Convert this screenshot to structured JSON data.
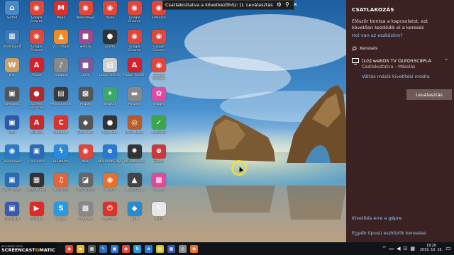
{
  "desktop": {
    "icons": [
      {
        "label": "Sorted",
        "glyph": "⌂",
        "color": "#4a89c8"
      },
      {
        "label": "Google Chrome",
        "glyph": "◉",
        "color": "#e0463a"
      },
      {
        "label": "Mega",
        "glyph": "M",
        "color": "#d9302c"
      },
      {
        "label": "WebsiteSpa",
        "glyph": "◉",
        "color": "#e0463a"
      },
      {
        "label": "fájlok",
        "glyph": "◉",
        "color": "#e0463a"
      },
      {
        "label": "Google Chrome",
        "glyph": "◉",
        "color": "#e0463a"
      },
      {
        "label": "eszközök",
        "glyph": "◉",
        "color": "#e0463a"
      },
      {
        "label": "Vezérlőpult",
        "glyph": "▦",
        "color": "#3c78b4"
      },
      {
        "label": "Google Chrome",
        "glyph": "◉",
        "color": "#e0463a"
      },
      {
        "label": "VLC Player",
        "glyph": "▲",
        "color": "#f28b22"
      },
      {
        "label": "webOS",
        "glyph": "■",
        "color": "#a04a8c"
      },
      {
        "label": "panda",
        "glyph": "●",
        "color": "#333333"
      },
      {
        "label": "Google Chrome",
        "glyph": "◉",
        "color": "#e0463a"
      },
      {
        "label": "Google Chrome",
        "glyph": "◉",
        "color": "#e0463a"
      },
      {
        "label": "Wiki",
        "glyph": "W",
        "color": "#c9a06a"
      },
      {
        "label": "Adobe",
        "glyph": "A",
        "color": "#d4202a"
      },
      {
        "label": "hangulat",
        "glyph": "♪",
        "color": "#888888"
      },
      {
        "label": "Lomo",
        "glyph": "■",
        "color": "#7a5a9a"
      },
      {
        "label": "Dokumentum",
        "glyph": "▤",
        "color": "#cfcfcf"
      },
      {
        "label": "Adobe Reader",
        "glyph": "A",
        "color": "#d4202a"
      },
      {
        "label": "Google Chrome",
        "glyph": "◉",
        "color": "#e0463a"
      },
      {
        "label": "Videószerk.",
        "glyph": "▣",
        "color": "#555555"
      },
      {
        "label": "Screen Recorder",
        "glyph": "●",
        "color": "#b02a2a"
      },
      {
        "label": "Media Center",
        "glyph": "▤",
        "color": "#3a3a3a"
      },
      {
        "label": "Mobile",
        "glyph": "▩",
        "color": "#555555"
      },
      {
        "label": "Network",
        "glyph": "✦",
        "color": "#3aa86a"
      },
      {
        "label": "Resolve",
        "glyph": "▬",
        "color": "#888888"
      },
      {
        "label": "Images",
        "glyph": "✿",
        "color": "#e04aa0"
      },
      {
        "label": "Intel",
        "glyph": "▣",
        "color": "#2a5aa8"
      },
      {
        "label": "ACDSee",
        "glyph": "A",
        "color": "#c82a2a"
      },
      {
        "label": "CCleaner",
        "glyph": "C",
        "color": "#d8342a"
      },
      {
        "label": "Game Ally",
        "glyph": "◆",
        "color": "#555555"
      },
      {
        "label": "Guardian",
        "glyph": "●",
        "color": "#333333"
      },
      {
        "label": "DVD Maker",
        "glyph": "◎",
        "color": "#b85a2a"
      },
      {
        "label": "Antivirus",
        "glyph": "✓",
        "color": "#3aa84a"
      },
      {
        "label": "TeamViewer",
        "glyph": "◉",
        "color": "#2a7ac8"
      },
      {
        "label": "Converter",
        "glyph": "▣",
        "color": "#2a6ab8"
      },
      {
        "label": "Bluetooth",
        "glyph": "ϟ",
        "color": "#2a8ae0"
      },
      {
        "label": "Web",
        "glyph": "◉",
        "color": "#e0463a"
      },
      {
        "label": "Microsoft Edge",
        "glyph": "e",
        "color": "#2a78d0"
      },
      {
        "label": "Maintenance",
        "glyph": "✹",
        "color": "#333333"
      },
      {
        "label": "Sense",
        "glyph": "⊕",
        "color": "#c83a3a"
      },
      {
        "label": "SWF Player",
        "glyph": "▣",
        "color": "#2a6ab8"
      },
      {
        "label": "WebOS File",
        "glyph": "▦",
        "color": "#333333"
      },
      {
        "label": "Audacity",
        "glyph": "♫",
        "color": "#e0663a"
      },
      {
        "label": "DVD Studio",
        "glyph": "◪",
        "color": "#666666"
      },
      {
        "label": "Firefox",
        "glyph": "◉",
        "color": "#e8702a"
      },
      {
        "label": "Photoshop",
        "glyph": "▲",
        "color": "#444444"
      },
      {
        "label": "Palette",
        "glyph": "▦",
        "color": "#e04a9a"
      },
      {
        "label": "Cyberlink",
        "glyph": "▣",
        "color": "#3a5ab0"
      },
      {
        "label": "YouTube",
        "glyph": "▶",
        "color": "#e02a2a"
      },
      {
        "label": "Skype",
        "glyph": "S",
        "color": "#2a9ae0"
      },
      {
        "label": "Program",
        "glyph": "▩",
        "color": "#888888"
      },
      {
        "label": "Recorder",
        "glyph": "⏻",
        "color": "#d8342a"
      },
      {
        "label": "Kodi",
        "glyph": "◆",
        "color": "#2a8ad0"
      },
      {
        "label": "Paint",
        "glyph": "✎",
        "color": "#e8e8e8"
      }
    ]
  },
  "cast_toolbar": {
    "text": "Csatlakoztatva a következőhöz: [L",
    "disconnect": "Leválasztás",
    "gear_glyph": "⚙",
    "pin_glyph": "⚲",
    "close_glyph": "✕"
  },
  "connect_pane": {
    "title": "CSATLAKOZÁS",
    "description": "Először bontsa a kapcsolatot, ezt követően kezdődik el a keresés",
    "where_link": "Hol van az eszközöm?",
    "search_label": "Keresés",
    "device": {
      "name": "[LG] webOS TV OLED55C8PLA",
      "status": "Csatlakoztatva – Másolás",
      "mode_link": "Váltás másik kivetítési módra",
      "disconnect_button": "Leválasztás"
    },
    "project_link": "Kivetítés erre a gépre",
    "other_devices_link": "Egyéb típusú eszközök keresése"
  },
  "taskbar": {
    "brand_recorded": "RECORDED WITH",
    "brand_screencast": "SCREENCAST",
    "brand_o": "O",
    "brand_matic": "MATIC",
    "apps": [
      {
        "name": "chrome",
        "glyph": "◉",
        "color": "#e0463a"
      },
      {
        "name": "explorer",
        "glyph": "▬",
        "color": "#e8b62a"
      },
      {
        "name": "calculator",
        "glyph": "▦",
        "color": "#555555"
      },
      {
        "name": "paint",
        "glyph": "✎",
        "color": "#2a6ab8"
      },
      {
        "name": "photos",
        "glyph": "▣",
        "color": "#2a78d0"
      },
      {
        "name": "chrome2",
        "glyph": "◉",
        "color": "#e0463a"
      },
      {
        "name": "skype",
        "glyph": "S",
        "color": "#2a9ae0"
      },
      {
        "name": "edge",
        "glyph": "e",
        "color": "#2a78d0"
      },
      {
        "name": "notes",
        "glyph": "▤",
        "color": "#d8c02a"
      },
      {
        "name": "files",
        "glyph": "▦",
        "color": "#3a5ab0"
      },
      {
        "name": "media",
        "glyph": "◎",
        "color": "#888888"
      },
      {
        "name": "firefox",
        "glyph": "◉",
        "color": "#e8702a"
      }
    ],
    "tray_chevron": "^",
    "tray_icons": [
      "▭",
      "◀",
      "⊡",
      "▦"
    ],
    "time": "18:20",
    "date": "2019. 10. 16.",
    "notification_glyph": "▭"
  }
}
